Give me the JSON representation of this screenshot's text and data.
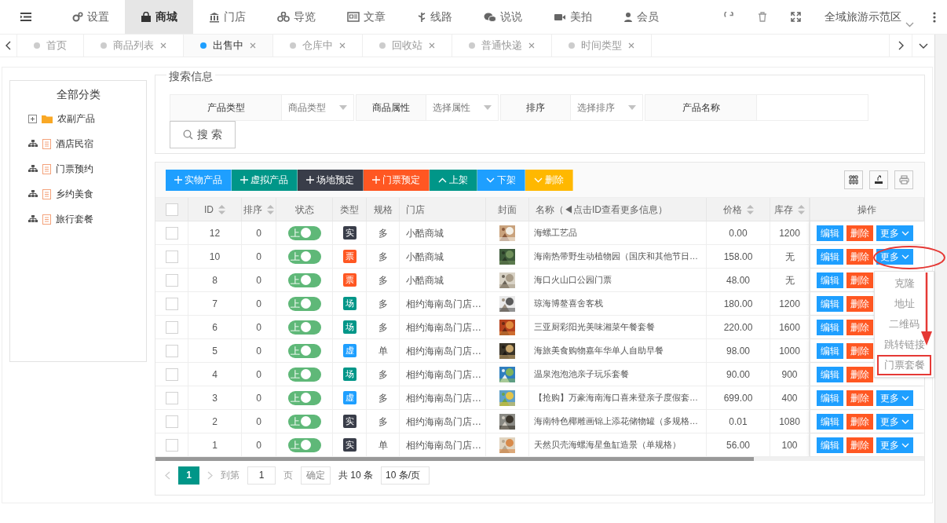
{
  "nav": {
    "items": [
      {
        "label": "设置",
        "selected": false
      },
      {
        "label": "商城",
        "selected": true
      },
      {
        "label": "门店",
        "selected": false
      },
      {
        "label": "导览",
        "selected": false
      },
      {
        "label": "文章",
        "selected": false
      },
      {
        "label": "线路",
        "selected": false
      },
      {
        "label": "说说",
        "selected": false
      },
      {
        "label": "美拍",
        "selected": false
      },
      {
        "label": "会员",
        "selected": false
      }
    ],
    "site": "全域旅游示范区"
  },
  "tabs": [
    {
      "label": "首页",
      "closable": false,
      "selected": false
    },
    {
      "label": "商品列表",
      "closable": true,
      "selected": false
    },
    {
      "label": "出售中",
      "closable": true,
      "selected": true
    },
    {
      "label": "仓库中",
      "closable": true,
      "selected": false
    },
    {
      "label": "回收站",
      "closable": true,
      "selected": false
    },
    {
      "label": "普通快递",
      "closable": true,
      "selected": false
    },
    {
      "label": "时间类型",
      "closable": true,
      "selected": false
    }
  ],
  "categories": {
    "title": "全部分类",
    "items": [
      {
        "label": "农副产品",
        "kind": "folder"
      },
      {
        "label": "酒店民宿",
        "kind": "leaf"
      },
      {
        "label": "门票预约",
        "kind": "leaf"
      },
      {
        "label": "乡约美食",
        "kind": "leaf"
      },
      {
        "label": "旅行套餐",
        "kind": "leaf"
      }
    ]
  },
  "search": {
    "legend": "搜索信息",
    "filters": [
      {
        "label": "产品类型",
        "placeholder": "商品类型",
        "kind": "select"
      },
      {
        "label": "商品属性",
        "placeholder": "选择属性",
        "kind": "select"
      },
      {
        "label": "排序",
        "placeholder": "选择排序",
        "kind": "select"
      },
      {
        "label": "产品名称",
        "kind": "input"
      }
    ],
    "button": "搜 索"
  },
  "toolbar": [
    {
      "label": "实物产品",
      "kind": "add",
      "color": "#1e9fff"
    },
    {
      "label": "虚拟产品",
      "kind": "add",
      "color": "#009688"
    },
    {
      "label": "场地预定",
      "kind": "add",
      "color": "#393d49"
    },
    {
      "label": "门票预定",
      "kind": "add",
      "color": "#ff5722"
    },
    {
      "label": "上架",
      "kind": "raise",
      "color": "#009688"
    },
    {
      "label": "下架",
      "kind": "lower",
      "color": "#1e9fff"
    },
    {
      "label": "删除",
      "kind": "lower",
      "color": "#ffb800"
    }
  ],
  "table": {
    "all_checked": false,
    "columns": [
      {
        "label": "ID",
        "sortable": true
      },
      {
        "label": "排序",
        "sortable": true
      },
      {
        "label": "状态",
        "sortable": false
      },
      {
        "label": "类型",
        "sortable": false
      },
      {
        "label": "规格",
        "sortable": false
      },
      {
        "label": "门店",
        "sortable": false
      },
      {
        "label": "封面",
        "sortable": false
      },
      {
        "label": "名称（◀点击ID查看更多信息）",
        "sortable": false
      },
      {
        "label": "价格",
        "sortable": true
      },
      {
        "label": "库存",
        "sortable": true
      },
      {
        "label": "操作",
        "sortable": false
      }
    ],
    "rows": [
      {
        "checked": false,
        "id": "12",
        "sort": "0",
        "status": {
          "label": "上",
          "on": true
        },
        "type": {
          "label": "实",
          "color": "#393d49"
        },
        "spec": "多",
        "store": "小酷商城",
        "name": "海螺工艺品",
        "price": "0.00",
        "stock": "1200",
        "actions": {
          "edit": "编辑",
          "delete": "删除",
          "more": "更多"
        }
      },
      {
        "checked": false,
        "id": "10",
        "sort": "0",
        "status": {
          "label": "上",
          "on": true
        },
        "type": {
          "label": "票",
          "color": "#ff5722"
        },
        "spec": "多",
        "store": "小酷商城",
        "name": "海南热带野生动植物园（国庆和其他节日…",
        "price": "158.00",
        "stock": "无",
        "actions": {
          "edit": "编辑",
          "delete": "删除",
          "more": "更多"
        }
      },
      {
        "checked": false,
        "id": "8",
        "sort": "0",
        "status": {
          "label": "上",
          "on": true
        },
        "type": {
          "label": "票",
          "color": "#ff5722"
        },
        "spec": "多",
        "store": "小酷商城",
        "name": "海口火山口公园门票",
        "price": "48.00",
        "stock": "无",
        "actions": {
          "edit": "编辑",
          "delete": "删除"
        }
      },
      {
        "checked": false,
        "id": "7",
        "sort": "0",
        "status": {
          "label": "上",
          "on": true
        },
        "type": {
          "label": "场",
          "color": "#009688"
        },
        "spec": "多",
        "store": "相约海南岛门店…",
        "name": "琼海博鳌喜舍客栈",
        "price": "180.00",
        "stock": "1200",
        "actions": {
          "edit": "编辑",
          "delete": "删除"
        }
      },
      {
        "checked": false,
        "id": "6",
        "sort": "0",
        "status": {
          "label": "上",
          "on": true
        },
        "type": {
          "label": "场",
          "color": "#009688"
        },
        "spec": "多",
        "store": "相约海南岛门店…",
        "name": "三亚厨彩阳光美味湘菜午餐套餐",
        "price": "220.00",
        "stock": "1600",
        "actions": {
          "edit": "编辑",
          "delete": "删除"
        }
      },
      {
        "checked": false,
        "id": "5",
        "sort": "0",
        "status": {
          "label": "上",
          "on": true
        },
        "type": {
          "label": "虚",
          "color": "#1e9fff"
        },
        "spec": "单",
        "store": "相约海南岛门店…",
        "name": "海旅美食购物嘉年华单人自助早餐",
        "price": "98.00",
        "stock": "1000",
        "actions": {
          "edit": "编辑",
          "delete": "删除"
        }
      },
      {
        "checked": false,
        "id": "4",
        "sort": "0",
        "status": {
          "label": "上",
          "on": true
        },
        "type": {
          "label": "场",
          "color": "#009688"
        },
        "spec": "多",
        "store": "相约海南岛门店…",
        "name": "温泉泡泡池亲子玩乐套餐",
        "price": "90.00",
        "stock": "900",
        "actions": {
          "edit": "编辑",
          "delete": "删除"
        }
      },
      {
        "checked": false,
        "id": "3",
        "sort": "0",
        "status": {
          "label": "上",
          "on": true
        },
        "type": {
          "label": "虚",
          "color": "#1e9fff"
        },
        "spec": "多",
        "store": "相约海南岛门店…",
        "name": "【抢购】万豪海南海口喜来登亲子度假套…",
        "price": "699.00",
        "stock": "400",
        "actions": {
          "edit": "编辑",
          "delete": "删除",
          "more": "更多"
        }
      },
      {
        "checked": false,
        "id": "2",
        "sort": "0",
        "status": {
          "label": "上",
          "on": true
        },
        "type": {
          "label": "实",
          "color": "#393d49"
        },
        "spec": "多",
        "store": "相约海南岛门店…",
        "name": "海南特色椰雕画锦上添花储物罐（多规格…",
        "price": "0.01",
        "stock": "1080",
        "actions": {
          "edit": "编辑",
          "delete": "删除",
          "more": "更多"
        }
      },
      {
        "checked": false,
        "id": "1",
        "sort": "0",
        "status": {
          "label": "上",
          "on": true
        },
        "type": {
          "label": "实",
          "color": "#393d49"
        },
        "spec": "单",
        "store": "相约海南岛门店…",
        "name": "天然贝壳海螺海星鱼缸造景（单规格）",
        "price": "56.00",
        "stock": "100",
        "actions": {
          "edit": "编辑",
          "delete": "删除",
          "more": "更多"
        }
      }
    ]
  },
  "more_menu": {
    "items": [
      {
        "label": "克隆",
        "highlighted": false
      },
      {
        "label": "地址",
        "highlighted": false
      },
      {
        "label": "二维码",
        "highlighted": false
      },
      {
        "label": "跳转链接",
        "highlighted": false
      },
      {
        "label": "门票套餐",
        "highlighted": true
      }
    ]
  },
  "pagination": {
    "pages": [
      {
        "label": "1",
        "selected": true
      }
    ],
    "goto_label": "到第",
    "goto_value": "1",
    "page_unit": "页",
    "confirm": "确定",
    "total": "共 10 条",
    "page_size": "10 条/页"
  }
}
